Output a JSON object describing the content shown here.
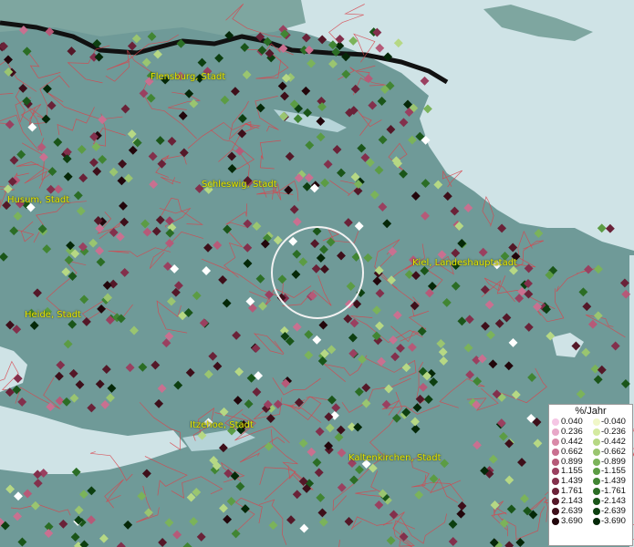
{
  "map": {
    "cities": [
      {
        "name": "Flensburg, Stadt"
      },
      {
        "name": "Husum, Stadt"
      },
      {
        "name": "Schleswig, Stadt"
      },
      {
        "name": "Kiel, Landeshauptstadt"
      },
      {
        "name": "Heide, Stadt"
      },
      {
        "name": "Itzehoe, Stadt"
      },
      {
        "name": "Kaltenkirchen, Stadt"
      }
    ]
  },
  "legend": {
    "title": "%/Jahr",
    "positive": [
      "0.040",
      "0.236",
      "0.442",
      "0.662",
      "0.899",
      "1.155",
      "1.439",
      "1.761",
      "2.143",
      "2.639",
      "3.690"
    ],
    "negative": [
      "-0.040",
      "-0.236",
      "-0.442",
      "-0.662",
      "-0.899",
      "-1.155",
      "-1.439",
      "-1.761",
      "-2.143",
      "-2.639",
      "-3.690"
    ],
    "positive_colors": [
      "#f5c6e4",
      "#e8a8c8",
      "#d98aa8",
      "#c97090",
      "#b65a78",
      "#9a4060",
      "#83304c",
      "#6a2238",
      "#541828",
      "#3e0f1a",
      "#22060b"
    ],
    "negative_colors": [
      "#f0f7c8",
      "#d4eaa0",
      "#b6d884",
      "#9ac570",
      "#7bb35a",
      "#5c9c44",
      "#418533",
      "#2b6d25",
      "#1a5519",
      "#0d3f10",
      "#052808"
    ]
  }
}
